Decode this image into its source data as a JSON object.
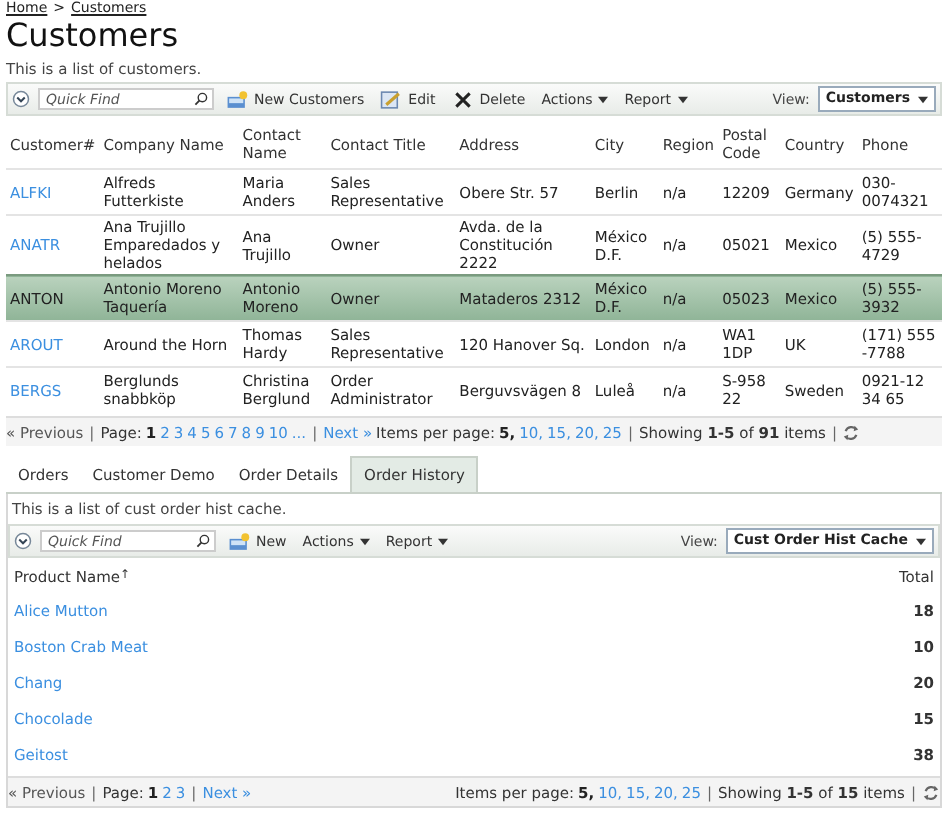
{
  "breadcrumb": [
    {
      "label": "Home"
    },
    {
      "label": "Customers"
    }
  ],
  "breadcrumb_separator": ">",
  "title": "Customers",
  "description": "This is a list of customers.",
  "toolbar": {
    "quick_find_placeholder": "Quick Find",
    "actions": [
      {
        "kind": "new",
        "label": "New Customers"
      },
      {
        "kind": "edit",
        "label": "Edit"
      },
      {
        "kind": "delete",
        "label": "Delete"
      },
      {
        "kind": "menu",
        "label": "Actions"
      },
      {
        "kind": "menu",
        "label": "Report"
      }
    ],
    "view_label": "View:",
    "view_value": "Customers"
  },
  "table": {
    "columns": [
      "Customer#",
      "Company Name",
      "Contact Name",
      "Contact Title",
      "Address",
      "City",
      "Region",
      "Postal Code",
      "Country",
      "Phone"
    ],
    "rows": [
      {
        "selected": false,
        "cells": [
          "ALFKI",
          "Alfreds Futterkiste",
          "Maria Anders",
          "Sales Representative",
          "Obere Str. 57",
          "Berlin",
          "n/a",
          "12209",
          "Germany",
          "030-0074321"
        ]
      },
      {
        "selected": false,
        "cells": [
          "ANATR",
          "Ana Trujillo Emparedados y helados",
          "Ana Trujillo",
          "Owner",
          "Avda. de la Constitución 2222",
          "México D.F.",
          "n/a",
          "05021",
          "Mexico",
          "(5) 555-4729"
        ]
      },
      {
        "selected": true,
        "cells": [
          "ANTON",
          "Antonio Moreno Taquería",
          "Antonio Moreno",
          "Owner",
          "Mataderos 2312",
          "México D.F.",
          "n/a",
          "05023",
          "Mexico",
          "(5) 555-3932"
        ]
      },
      {
        "selected": false,
        "cells": [
          "AROUT",
          "Around the Horn",
          "Thomas Hardy",
          "Sales Representative",
          "120 Hanover Sq.",
          "London",
          "n/a",
          "WA1 1DP",
          "UK",
          "(171) 555 -7788"
        ]
      },
      {
        "selected": false,
        "cells": [
          "BERGS",
          "Berglunds snabbköp",
          "Christina Berglund",
          "Order Administrator",
          "Berguvsvägen 8",
          "Luleå",
          "n/a",
          "S-958 22",
          "Sweden",
          "0921-12 34 65"
        ]
      }
    ]
  },
  "pager": {
    "previous": "« Previous",
    "page_label": "Page:",
    "pages": [
      {
        "label": "1",
        "selected": true
      },
      {
        "label": "2",
        "selected": false
      },
      {
        "label": "3",
        "selected": false
      },
      {
        "label": "4",
        "selected": false
      },
      {
        "label": "5",
        "selected": false
      },
      {
        "label": "6",
        "selected": false
      },
      {
        "label": "7",
        "selected": false
      },
      {
        "label": "8",
        "selected": false
      },
      {
        "label": "9",
        "selected": false
      },
      {
        "label": "10",
        "selected": false
      },
      {
        "label": "...",
        "selected": false
      }
    ],
    "next": "Next »",
    "items_label": "Items per page:",
    "sizes": [
      {
        "label": "5,",
        "selected": true
      },
      {
        "label": "10,",
        "selected": false
      },
      {
        "label": "15,",
        "selected": false
      },
      {
        "label": "20,",
        "selected": false
      },
      {
        "label": "25",
        "selected": false
      }
    ],
    "showing": "Showing **1-5** of **91** items",
    "separator": "|"
  },
  "tabs": [
    {
      "label": "Orders",
      "selected": false
    },
    {
      "label": "Customer Demo",
      "selected": false
    },
    {
      "label": "Order Details",
      "selected": false
    },
    {
      "label": "Order History",
      "selected": true
    }
  ],
  "detail": {
    "description": "This is a list of cust order hist cache.",
    "toolbar": {
      "quick_find_placeholder": "Quick Find",
      "actions": [
        {
          "kind": "new",
          "label": "New"
        },
        {
          "kind": "menu",
          "label": "Actions"
        },
        {
          "kind": "menu",
          "label": "Report"
        }
      ],
      "view_label": "View:",
      "view_value": "Cust Order Hist Cache"
    },
    "table": {
      "columns": [
        "Product Name",
        "Total"
      ],
      "sort_mark": "↑",
      "rows": [
        [
          "Alice Mutton",
          "18"
        ],
        [
          "Boston Crab Meat",
          "10"
        ],
        [
          "Chang",
          "20"
        ],
        [
          "Chocolade",
          "15"
        ],
        [
          "Geitost",
          "38"
        ]
      ]
    },
    "pager": {
      "previous": "« Previous",
      "page_label": "Page:",
      "pages": [
        {
          "label": "1",
          "selected": true
        },
        {
          "label": "2",
          "selected": false
        },
        {
          "label": "3",
          "selected": false
        }
      ],
      "next": "Next »",
      "items_label": "Items per page:",
      "sizes": [
        {
          "label": "5,",
          "selected": true
        },
        {
          "label": "10,",
          "selected": false
        },
        {
          "label": "15,",
          "selected": false
        },
        {
          "label": "20,",
          "selected": false
        },
        {
          "label": "25",
          "selected": false
        }
      ],
      "showing": "Showing **1-5** of **15** items",
      "separator": "|"
    }
  }
}
